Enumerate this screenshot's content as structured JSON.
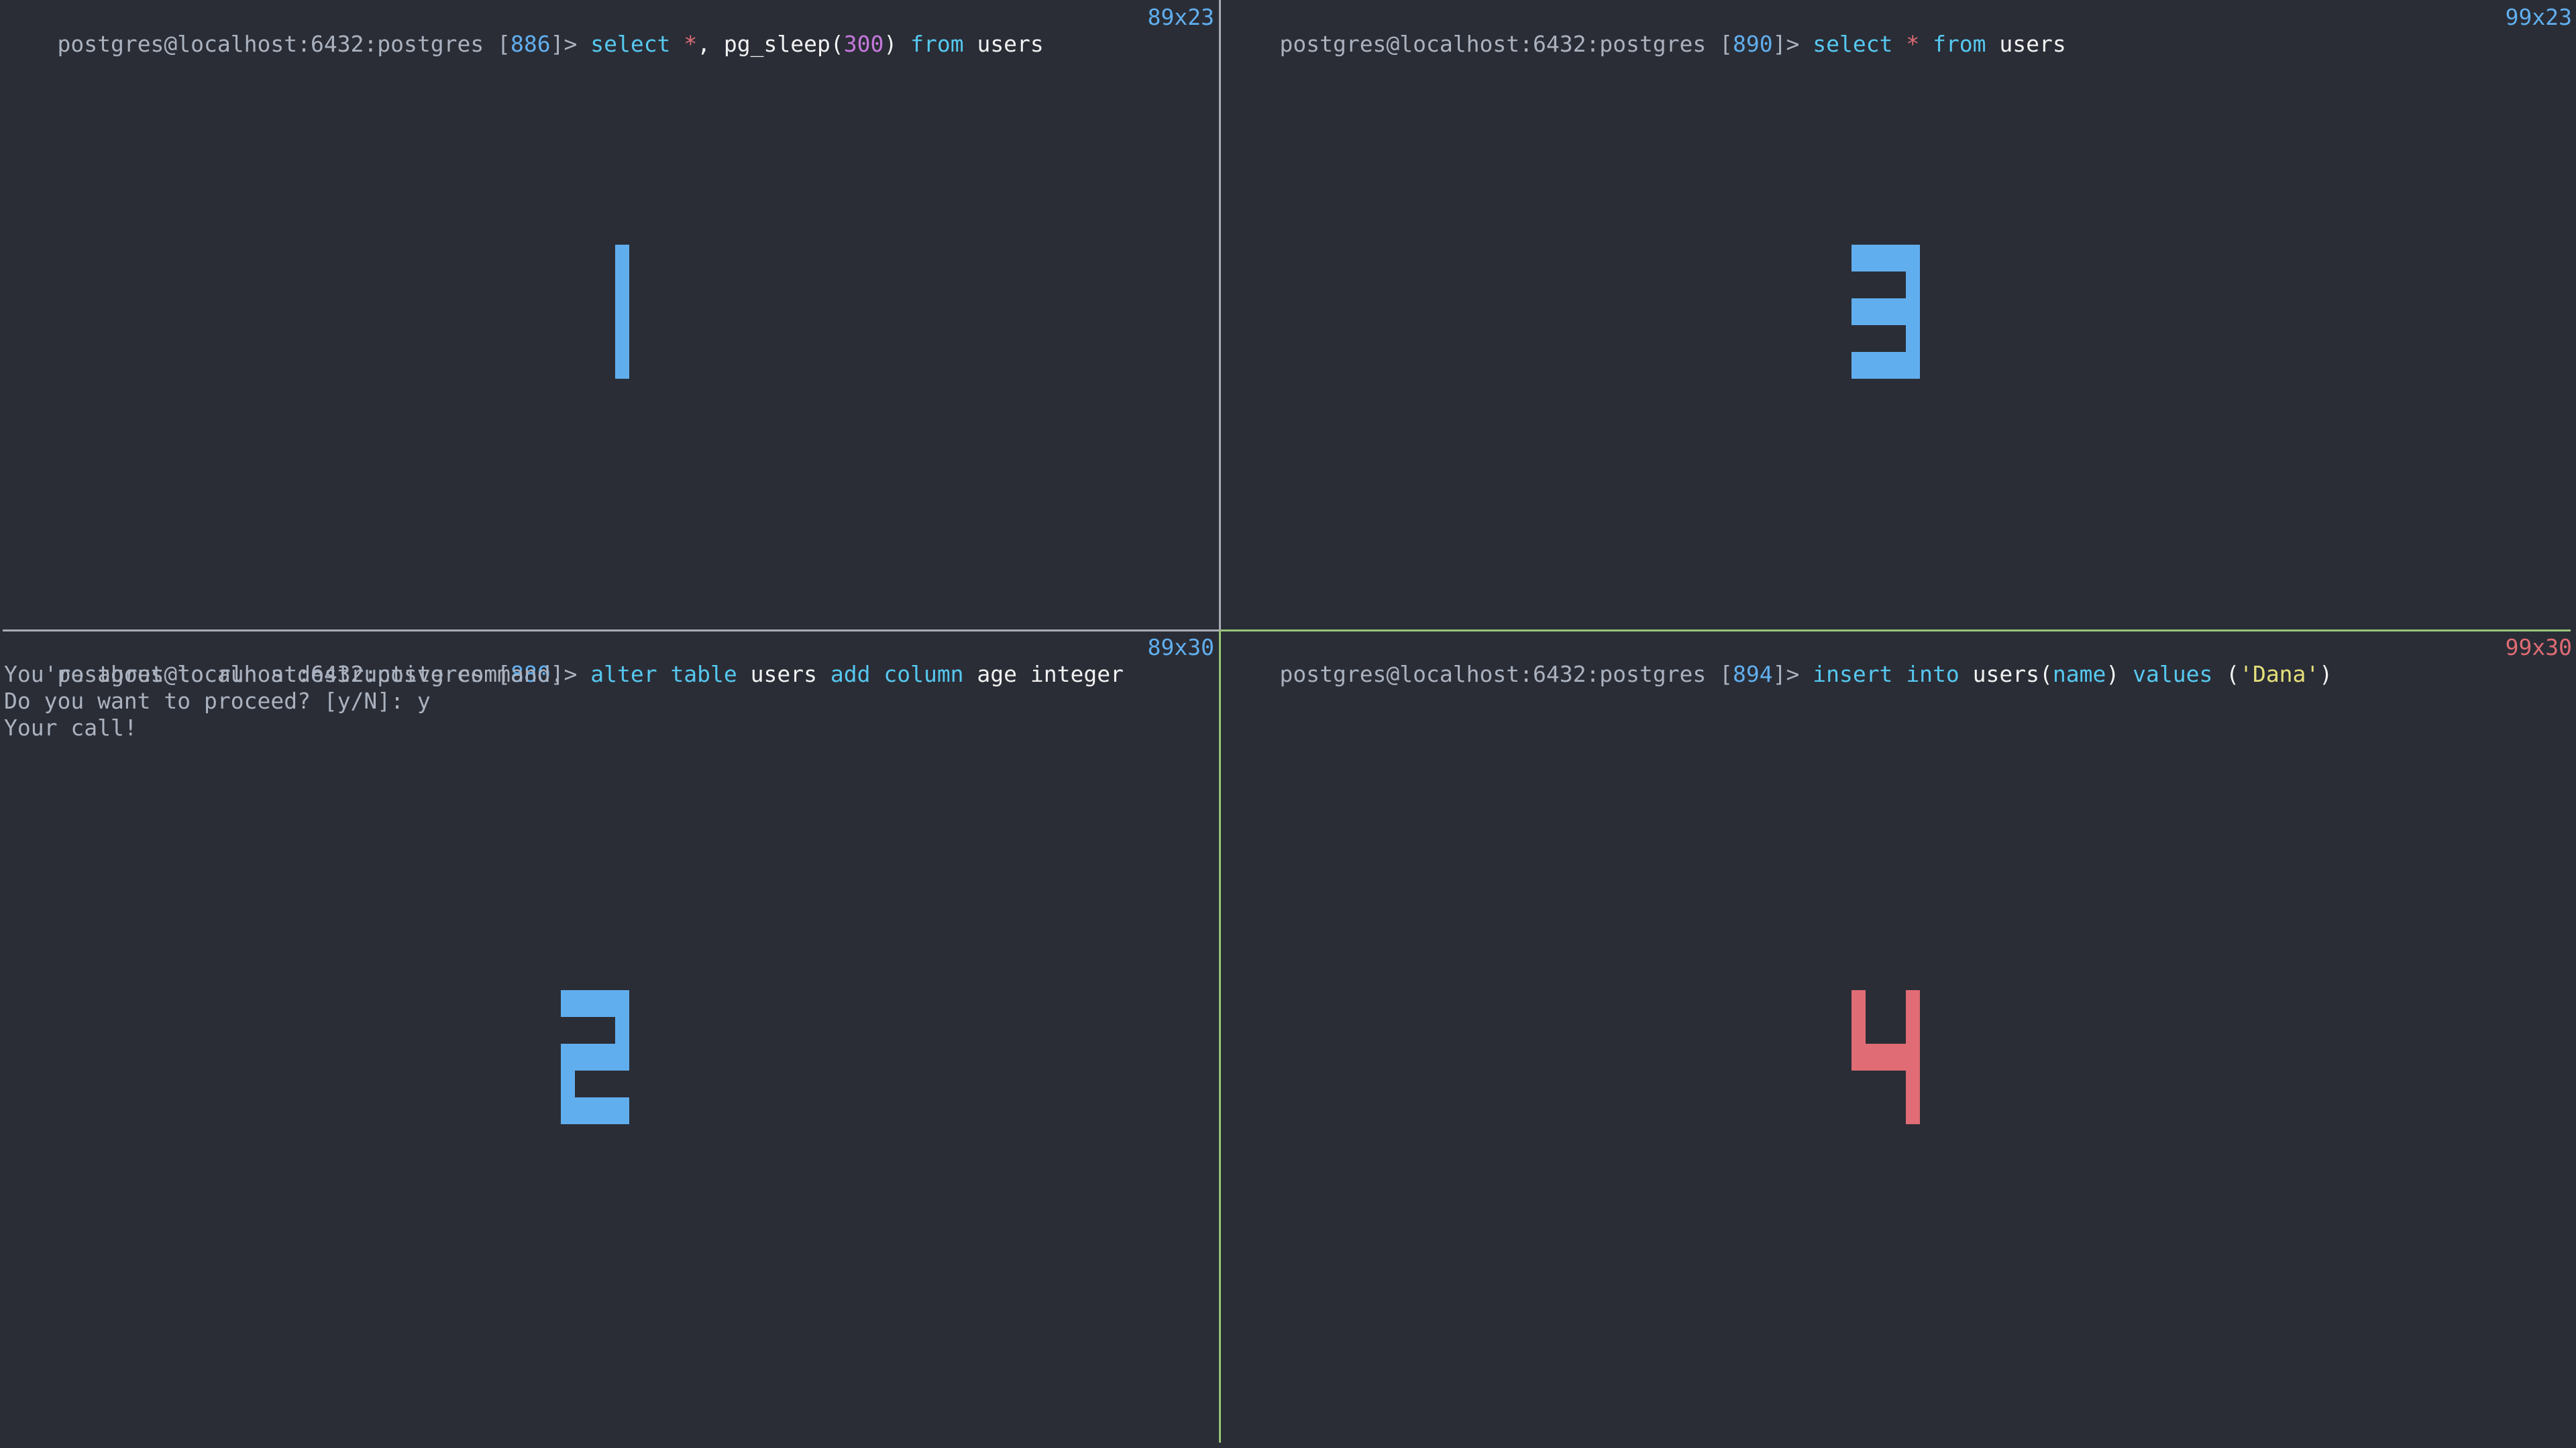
{
  "app": "tmux split-pane terminal (pgcli sessions)",
  "colors": {
    "background": "#2a2d36",
    "prompt": "#abb2bf",
    "pid": "#61afef",
    "keyword": "#56c8f0",
    "identifier": "#f2f2f2",
    "operator": "#e06c75",
    "number": "#c678dd",
    "string": "#e5e07b",
    "active_border": "#98c379",
    "inactive_border": "#a8acb5",
    "pane_number_inactive": "#61aeee",
    "pane_number_active": "#e06c75"
  },
  "panes": [
    {
      "pane_number": "1",
      "active": false,
      "size": "89x23",
      "prompt": {
        "user_host": "postgres@localhost:6432:postgres ",
        "open": "[",
        "pid": "886",
        "close": "]> "
      },
      "command": {
        "t1": "select",
        "t2": " ",
        "t3": "*",
        "t4": ", pg_sleep(",
        "t5": "300",
        "t6": ") ",
        "t7": "from",
        "t8": " users"
      },
      "output": []
    },
    {
      "pane_number": "2",
      "active": false,
      "size": "89x30",
      "prompt": {
        "user_host": "postgres@localhost:6432:postgres ",
        "open": "[",
        "pid": "880",
        "close": "]> "
      },
      "command": {
        "t1": "alter",
        "t2": " ",
        "t3": "table",
        "t4": " users ",
        "t5": "add",
        "t6": " ",
        "t7": "column",
        "t8": " age integer"
      },
      "output": [
        "You're about to run a destructive command.",
        "Do you want to proceed? [y/N]: y",
        "Your call!"
      ]
    },
    {
      "pane_number": "3",
      "active": false,
      "size": "99x23",
      "prompt": {
        "user_host": "postgres@localhost:6432:postgres ",
        "open": "[",
        "pid": "890",
        "close": "]> "
      },
      "command": {
        "t1": "select",
        "t2": " ",
        "t3": "*",
        "t4": " ",
        "t5": "from",
        "t6": " users"
      },
      "output": []
    },
    {
      "pane_number": "4",
      "active": true,
      "size": "99x30",
      "prompt": {
        "user_host": "postgres@localhost:6432:postgres ",
        "open": "[",
        "pid": "894",
        "close": "]> "
      },
      "command": {
        "t1": "insert",
        "t2": " ",
        "t3": "into",
        "t4": " users(",
        "t5": "name",
        "t6": ") ",
        "t7": "values",
        "t8": " (",
        "t9": "'Dana'",
        "t10": ")"
      },
      "output": []
    }
  ]
}
